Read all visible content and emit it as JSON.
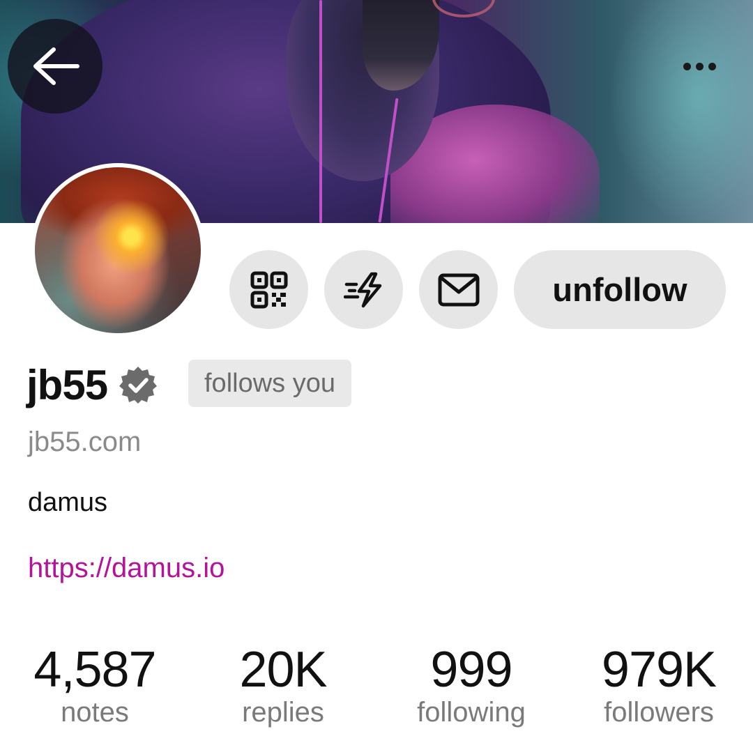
{
  "profile": {
    "display_name": "jb55",
    "follows_you": "follows you",
    "nip05": "jb55.com",
    "about": "damus",
    "website": "https://damus.io"
  },
  "actions": {
    "unfollow_label": "unfollow"
  },
  "icons": {
    "back": "arrow-left-icon",
    "menu": "ellipsis-icon",
    "qr": "qr-code-icon",
    "zap": "zap-icon",
    "message": "envelope-icon",
    "verified": "verified-badge-icon"
  },
  "stats": [
    {
      "value": "4,587",
      "label": "notes"
    },
    {
      "value": "20K",
      "label": "replies"
    },
    {
      "value": "999",
      "label": "following"
    },
    {
      "value": "979K",
      "label": "followers"
    }
  ],
  "colors": {
    "link": "#b4129b",
    "button_bg": "#e6e6e6",
    "muted_text": "#8a8a8a"
  }
}
